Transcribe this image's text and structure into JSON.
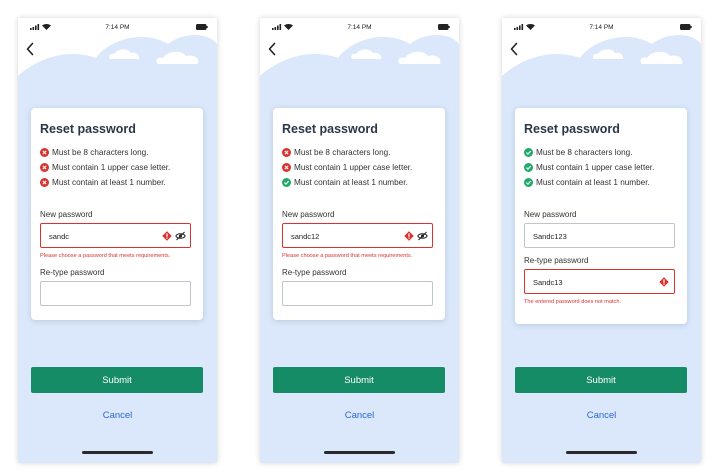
{
  "status": {
    "time": "7:14 PM"
  },
  "card": {
    "title": "Reset password"
  },
  "requirements": [
    "Must be 8 characters long.",
    "Must contain 1 upper case letter.",
    "Must contain at least 1 number."
  ],
  "labels": {
    "new_password": "New password",
    "retype_password": "Re-type password"
  },
  "buttons": {
    "submit": "Submit",
    "cancel": "Cancel"
  },
  "errors": {
    "requirements": "Please choose a password that meets requirements.",
    "mismatch": "The entered password does not match."
  },
  "screens": [
    {
      "new_password_value": "sandc",
      "retype_value": "",
      "requirements_met": [
        false,
        false,
        false
      ]
    },
    {
      "new_password_value": "sandc12",
      "retype_value": "",
      "requirements_met": [
        false,
        false,
        true
      ]
    },
    {
      "new_password_value": "Sandc123",
      "retype_value": "Sandc13",
      "requirements_met": [
        true,
        true,
        true
      ]
    }
  ],
  "colors": {
    "accent": "#168c66",
    "error": "#d9332f",
    "success": "#1faa6a",
    "link": "#2f66d0",
    "background_shape": "#dbe8fb"
  },
  "icons": [
    "signal-icon",
    "wifi-icon",
    "battery-icon",
    "back-chevron-icon",
    "error-x-icon",
    "check-icon",
    "warning-icon",
    "eye-slash-icon"
  ]
}
